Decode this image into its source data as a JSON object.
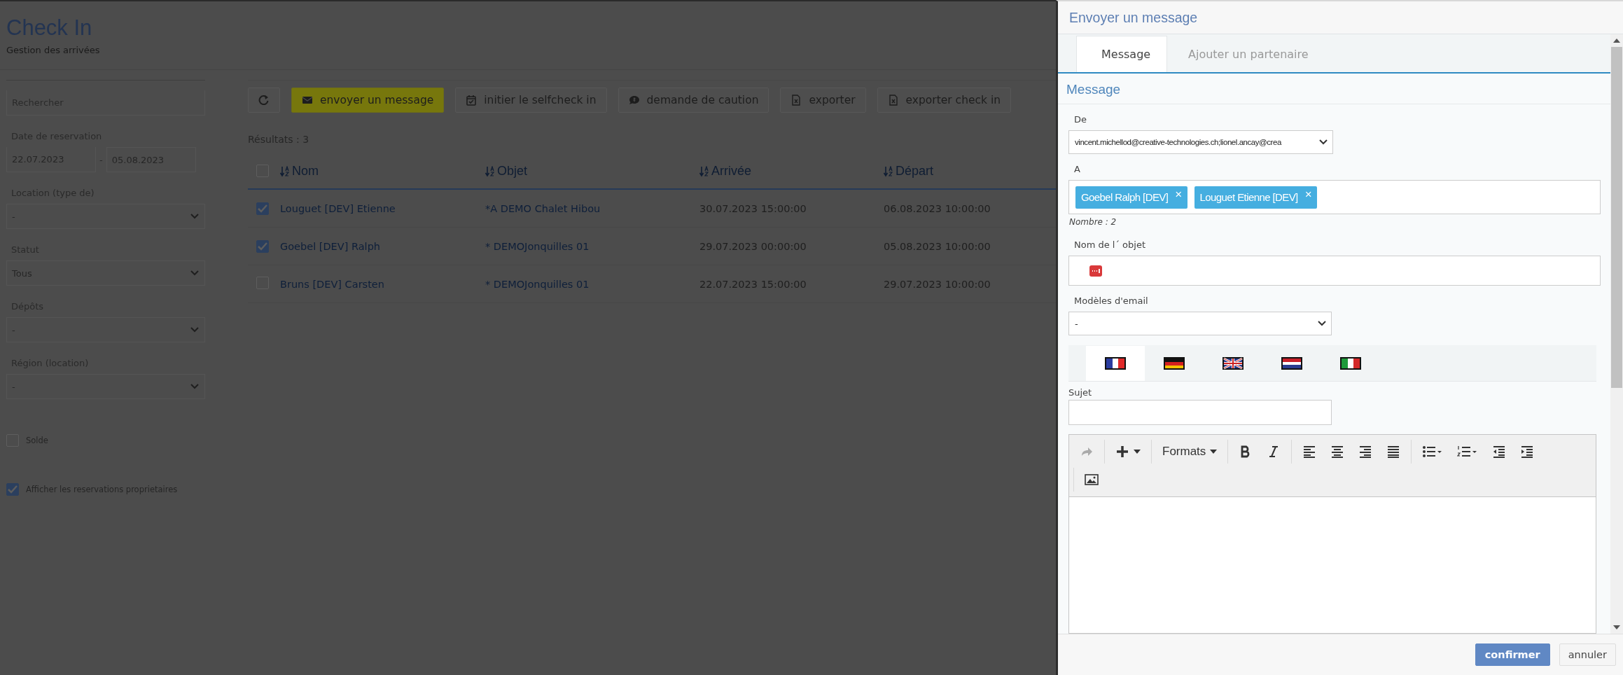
{
  "page": {
    "title": "Check In",
    "subtitle": "Gestion des arrivées"
  },
  "filters": {
    "search": {
      "placeholder": "Rechercher"
    },
    "date_label": "Date de reservation",
    "date_from": "22.07.2023",
    "date_separator": "-",
    "date_to": "05.08.2023",
    "selects": [
      {
        "label": "Location (type de)",
        "value": "-"
      },
      {
        "label": "Statut",
        "value": "Tous"
      },
      {
        "label": "Dépôts",
        "value": "-"
      },
      {
        "label": "Région (location)",
        "value": "-"
      }
    ],
    "checkboxes": [
      {
        "label": "Solde",
        "checked": false
      },
      {
        "label": "Afficher les reservations proprietaires",
        "checked": true
      }
    ]
  },
  "toolbar": [
    {
      "kind": "refresh"
    },
    {
      "kind": "envelope",
      "label": "envoyer un message",
      "highlighted": true
    },
    {
      "kind": "calendar",
      "label": "initier le selfcheck in",
      "highlighted": false
    },
    {
      "kind": "chat",
      "label": "demande de caution",
      "highlighted": false
    },
    {
      "kind": "file",
      "label": "exporter",
      "highlighted": false
    },
    {
      "kind": "file",
      "label": "exporter check in",
      "highlighted": false
    }
  ],
  "results": "Résultats : 3",
  "table": {
    "header_checked": false,
    "columns": [
      "Nom",
      "Objet",
      "Arrivée",
      "Départ"
    ],
    "rows": [
      {
        "checked": true,
        "cells": [
          "Louguet [DEV] Etienne",
          "*A DEMO Chalet Hibou",
          "30.07.2023 15:00:00",
          "06.08.2023 10:00:00"
        ]
      },
      {
        "checked": true,
        "cells": [
          "Goebel [DEV] Ralph",
          "* DEMOJonquilles 01",
          "29.07.2023 00:00:00",
          "05.08.2023 10:00:00"
        ]
      },
      {
        "checked": false,
        "cells": [
          "Bruns [DEV] Carsten",
          "* DEMOJonquilles 01",
          "22.07.2023 15:00:00",
          "29.07.2023 10:00:00"
        ]
      }
    ]
  },
  "dialog": {
    "title": "Envoyer un message",
    "tabs": [
      {
        "label": "Message",
        "selected": true
      },
      {
        "label": "Ajouter un partenaire",
        "selected": false
      }
    ],
    "section_title": "Message",
    "from": {
      "label": "De",
      "value": "vincent.michellod@creative-technologies.ch;lionel.ancay@crea"
    },
    "to": {
      "label": "A",
      "tags": [
        "Goebel Ralph [DEV]",
        "Louguet Etienne [DEV]"
      ],
      "remove_glyph": "×",
      "count": "Nombre : 2"
    },
    "object": {
      "label": "Nom de l´ objet"
    },
    "template": {
      "label": "Modèles d'email",
      "value": "-"
    },
    "languages": [
      {
        "kind": "fr",
        "selected": true
      },
      {
        "kind": "de",
        "selected": false
      },
      {
        "kind": "gb",
        "selected": false
      },
      {
        "kind": "nl",
        "selected": false
      },
      {
        "kind": "it",
        "selected": false
      }
    ],
    "subject": {
      "label": "Sujet"
    },
    "editor": {
      "rows": [
        [
          [
            {
              "kind": "redo",
              "disabled": true
            }
          ],
          [
            {
              "kind": "insert",
              "disabled": false
            }
          ],
          [
            {
              "kind": "formats",
              "label": "Formats",
              "disabled": false
            }
          ],
          [
            {
              "kind": "bold",
              "disabled": false
            },
            {
              "kind": "italic",
              "disabled": false
            }
          ],
          [
            {
              "kind": "align-left",
              "disabled": false
            },
            {
              "kind": "align-center",
              "disabled": false
            },
            {
              "kind": "align-right",
              "disabled": false
            },
            {
              "kind": "align-justify",
              "disabled": false
            }
          ],
          [
            {
              "kind": "bullet-list",
              "disabled": false
            },
            {
              "kind": "numbered-list",
              "disabled": false
            },
            {
              "kind": "outdent",
              "disabled": false
            },
            {
              "kind": "indent",
              "disabled": false
            }
          ]
        ],
        [
          [
            {
              "kind": "image",
              "disabled": false
            }
          ]
        ]
      ]
    },
    "buttons": [
      {
        "label": "confirmer",
        "kind": "primary"
      },
      {
        "label": "annuler",
        "kind": "default"
      }
    ]
  }
}
